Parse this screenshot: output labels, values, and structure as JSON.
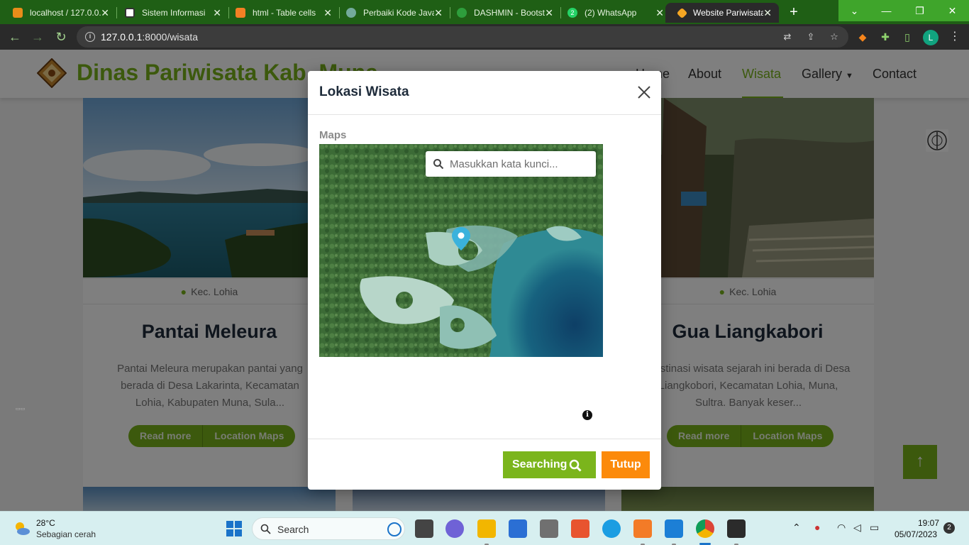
{
  "browser": {
    "tabs": [
      {
        "title": "localhost / 127.0.0.1",
        "favicon_color": "#e88d1a"
      },
      {
        "title": "Sistem Informasi",
        "favicon_color": "#ffffff"
      },
      {
        "title": "html - Table cells",
        "favicon_color": "#f48024"
      },
      {
        "title": "Perbaiki Kode Java",
        "favicon_color": "#74aa9c"
      },
      {
        "title": "DASHMIN - Bootstrap",
        "favicon_color": "#2e9e3c"
      },
      {
        "title": "(2) WhatsApp",
        "favicon_color": "#25d366",
        "badge": "2"
      },
      {
        "title": "Website Pariwisata",
        "favicon_color": "#f5a623"
      }
    ],
    "active_tab": 6,
    "new_tab_label": "+",
    "url_host": "127.0.0.1",
    "url_rest": ":8000/wisata",
    "profile_initial": "L"
  },
  "site": {
    "brand": "Dinas Pariwisata Kab. Muna",
    "menu": [
      "Home",
      "About",
      "Wisata",
      "Gallery",
      "Contact"
    ],
    "active_menu": "Wisata",
    "accent_color": "#78b31a"
  },
  "cards": [
    {
      "location": "Kec. Lohia",
      "title": "Pantai Meleura",
      "description": "Pantai Meleura merupakan pantai yang berada di Desa Lakarinta, Kecamatan Lohia, Kabupaten Muna, Sula...",
      "read_more": "Read more",
      "location_maps": "Location Maps"
    },
    {
      "location": "Kec. Lohia",
      "title": "Gua Liangkabori",
      "description": "Destinasi wisata sejarah ini berada di Desa Liangkobori, Kecamatan Lohia, Muna, Sultra. Banyak keser...",
      "read_more": "Read more",
      "location_maps": "Location Maps"
    }
  ],
  "modal": {
    "title": "Lokasi Wisata",
    "maps_label": "Maps",
    "search_placeholder": "Masukkan kata kunci...",
    "search_button": "Searching",
    "close_button": "Tutup",
    "search_button_color": "#7bb51c",
    "close_button_color": "#fc8a0b"
  },
  "taskbar": {
    "temperature": "28°C",
    "weather": "Sebagian cerah",
    "search_label": "Search",
    "time": "19:07",
    "date": "05/07/2023",
    "notification_count": "2"
  }
}
